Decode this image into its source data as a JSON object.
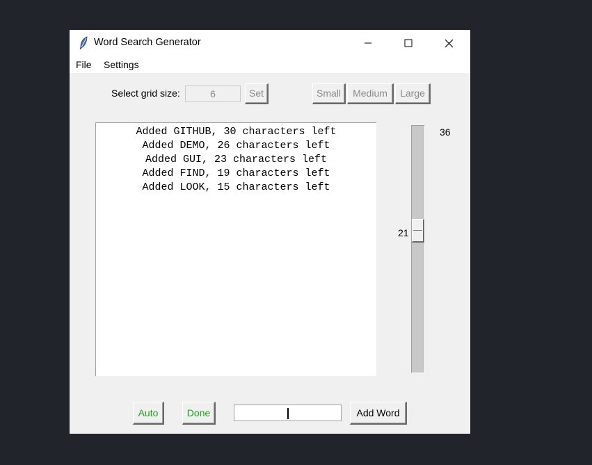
{
  "window": {
    "title": "Word Search Generator",
    "icon": "feather-icon",
    "controls": [
      "minimize-icon",
      "maximize-icon",
      "close-icon"
    ]
  },
  "menu": {
    "file": "File",
    "settings": "Settings"
  },
  "grid_size": {
    "label": "Select grid size:",
    "value": "6",
    "set_label": "Set",
    "presets": [
      "Small",
      "Medium",
      "Large"
    ]
  },
  "log": {
    "lines": [
      "Added GITHUB, 30 characters left",
      "Added DEMO, 26 characters left",
      "Added GUI, 23 characters left",
      "Added FIND, 19 characters left",
      "Added LOOK, 15 characters left"
    ]
  },
  "scale": {
    "max": "36",
    "value": "21"
  },
  "actions": {
    "auto": "Auto",
    "done": "Done",
    "word_input_value": "",
    "add_word": "Add Word"
  },
  "colors": {
    "desktop": "#21242b",
    "window_bg": "#f0f0f0",
    "disabled_text": "#8a8a8a",
    "green_text": "#1f9d1f"
  }
}
